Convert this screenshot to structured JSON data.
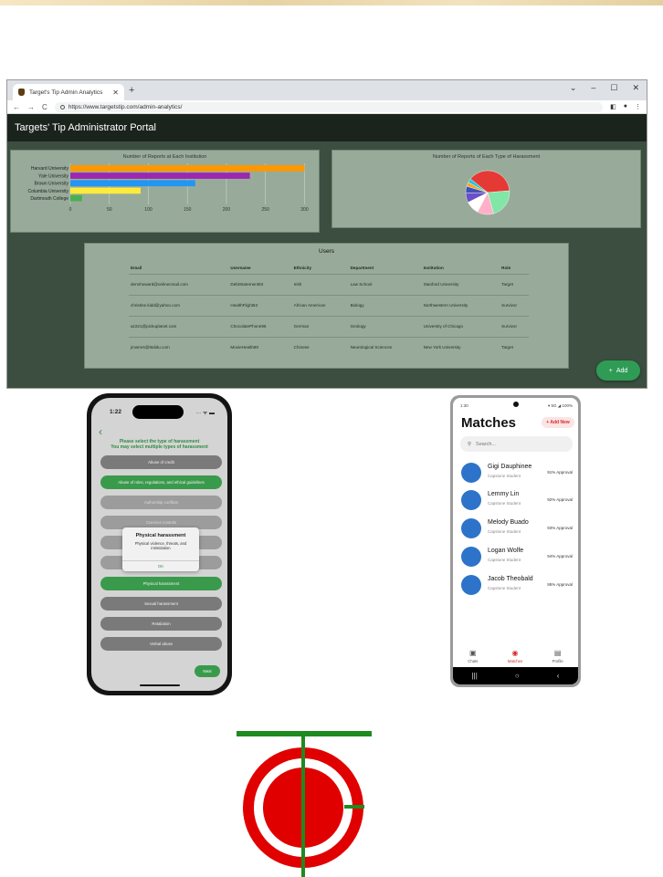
{
  "browser": {
    "tab_title": "Target's Tip Admin Analytics",
    "url": "https://www.targetstip.com/admin-analytics/",
    "portal_title": "Targets' Tip Administrator Portal",
    "add_label": "Add",
    "bar_chart_title": "Number of Reports at Each Institution",
    "pie_chart_title": "Number of Reports of Each Type of Harassment",
    "users_title": "Users",
    "columns": [
      "Email",
      "Username",
      "Ethnicity",
      "Department",
      "Institution",
      "Role"
    ],
    "rows": [
      [
        "dennhoward@onlinecmail.com",
        "DebtStatement93",
        "Irish",
        "Law School",
        "Stanford University",
        "Target"
      ],
      [
        "christine.kidd@yahoo.com",
        "HealthFlight53",
        "African American",
        "Biology",
        "Northwestern University",
        "Survivor"
      ],
      [
        "az221@pickuplanet.com",
        "ChocolatePhone96",
        "German",
        "Geology",
        "University of Chicago",
        "Survivor"
      ],
      [
        "jmwmrs@ttalidu.com",
        "MovieHealth80",
        "Chinese",
        "Neurological Sciences",
        "New York University",
        "Target"
      ]
    ]
  },
  "chart_data": [
    {
      "type": "bar",
      "orientation": "horizontal",
      "title": "Number of Reports at Each Institution",
      "categories": [
        "Harvard University",
        "Yale University",
        "Brown University",
        "Columbia University",
        "Dartmouth College"
      ],
      "values": [
        300,
        230,
        160,
        90,
        15
      ],
      "colors": [
        "#ff9800",
        "#9c27b0",
        "#2196f3",
        "#ffeb3b",
        "#4caf50"
      ],
      "xlim": [
        0,
        310
      ],
      "xticks": [
        0,
        50,
        100,
        150,
        200,
        250,
        300
      ],
      "grid": true
    },
    {
      "type": "pie",
      "title": "Number of Reports of Each Type of Harassment",
      "values": [
        38,
        22,
        12,
        10,
        7,
        5,
        3,
        3
      ],
      "colors": [
        "#e53935",
        "#81e6a6",
        "#ffb0c8",
        "#ffffff",
        "#6a4fc8",
        "#3f51b5",
        "#f6a623",
        "#26c6da"
      ]
    }
  ],
  "iphone": {
    "time": "1:22",
    "heading_line1": "Please select the type of harassment",
    "heading_line2": "You may select multiple types of harassment",
    "options": [
      "Abuse of credit",
      "Abuse of roles, regulations, and ethical guidelines",
      "Authorship conflicts",
      "Coercive controls",
      "",
      "",
      "Physical harassment",
      "Sexual harassment",
      "Retaliation",
      "Verbal abuse"
    ],
    "selected": [
      1,
      6
    ],
    "modal_title": "Physical harassment",
    "modal_body": "Physical violence, threats, and intimidation",
    "modal_ok": "OK",
    "next_label": "Next"
  },
  "android": {
    "time": "1:30",
    "status": "▾ 5G ◢ 100%",
    "title": "Matches",
    "add_new": "+ Add New",
    "search_placeholder": "Search...",
    "matches": [
      {
        "name": "Gigi Dauphinee",
        "role": "Capstone Student",
        "approval": "91% Approval"
      },
      {
        "name": "Lemmy Lin",
        "role": "Capstone Student",
        "approval": "92% Approval"
      },
      {
        "name": "Melody Buado",
        "role": "Capstone Student",
        "approval": "93% Approval"
      },
      {
        "name": "Logan Wolfe",
        "role": "Capstone Student",
        "approval": "94% Approval"
      },
      {
        "name": "Jacob Theobald",
        "role": "Capstone Student",
        "approval": "95% Approval"
      }
    ],
    "nav": {
      "chats": "Chats",
      "matches": "Matches",
      "profile": "Profile"
    }
  },
  "colors": {
    "portal_bg": "#3b4e3f",
    "header_bg": "#1b231d",
    "panel_bg": "#98ab9a",
    "accent_green": "#2e9c55",
    "match_red": "#d62b2b",
    "avatar_blue": "#2d73c9",
    "logo_red": "#e00000",
    "logo_green": "#1f8a1f"
  }
}
